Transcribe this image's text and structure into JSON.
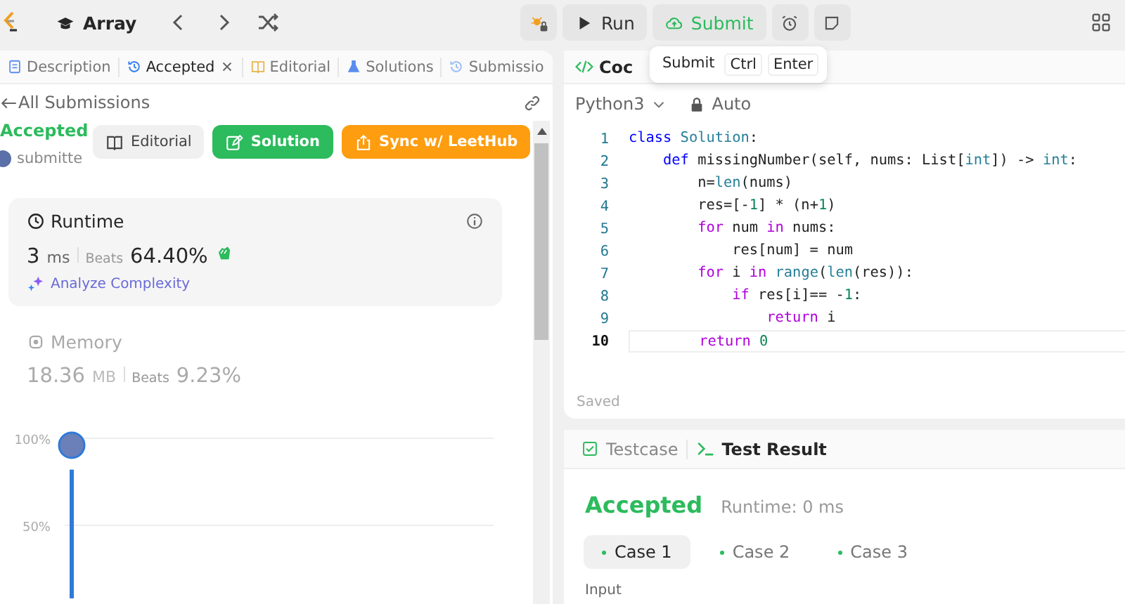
{
  "top_bar": {
    "problem_list": "Array",
    "actions": [
      {
        "label": "Run",
        "kind": "run"
      },
      {
        "label": "Submit",
        "kind": "submit"
      }
    ],
    "tooltip": [
      "Submit",
      "Ctrl",
      "Enter"
    ]
  },
  "left_panel": {
    "tabs": [
      {
        "label": "Description",
        "selected": false,
        "closable": false
      },
      {
        "label": "Accepted",
        "selected": true,
        "closable": true
      },
      {
        "label": "Editorial",
        "selected": false,
        "closable": false
      },
      {
        "label": "Solutions",
        "selected": false,
        "closable": false
      },
      {
        "label": "Submissio",
        "selected": false,
        "closable": false
      }
    ],
    "back_link": "All Submissions",
    "status": "Accepted",
    "author": "submitte",
    "buttons": [
      {
        "label": "Editorial",
        "kind": "plain"
      },
      {
        "label": "Solution",
        "kind": "green"
      },
      {
        "label": "Sync w/ LeetHub",
        "kind": "orange"
      }
    ],
    "runtime": {
      "title": "Runtime",
      "value": "3",
      "unit": "ms",
      "beats_label": "Beats",
      "beats": "64.40%",
      "link": "Analyze Complexity"
    },
    "memory": {
      "title": "Memory",
      "value": "18.36",
      "unit": "MB",
      "beats_label": "Beats",
      "beats": "9.23%"
    },
    "chart_data": {
      "type": "bar",
      "values": [
        82
      ],
      "ylim": [
        0,
        100
      ],
      "yticks": [
        {
          "value": 100,
          "label": "100%"
        },
        {
          "value": 50,
          "label": "50%"
        }
      ]
    }
  },
  "code_panel": {
    "tab": "Coc",
    "language": "Python3",
    "mode": "Auto",
    "lines": [
      {
        "number": "1",
        "active": false,
        "tokens": [
          {
            "t": "class",
            "kind": "keyword"
          },
          {
            "t": " Solution",
            "kind": "builtin"
          },
          {
            "t": ":",
            "kind": "plain"
          }
        ]
      },
      {
        "number": "2",
        "active": false,
        "tokens": [
          {
            "t": "    def",
            "kind": "keyword"
          },
          {
            "t": " missingNumber(self, nums: List[",
            "kind": "plain"
          },
          {
            "t": "int",
            "kind": "builtin"
          },
          {
            "t": "]) -> ",
            "kind": "plain"
          },
          {
            "t": "int",
            "kind": "builtin"
          },
          {
            "t": ":",
            "kind": "plain"
          }
        ]
      },
      {
        "number": "3",
        "active": false,
        "tokens": [
          {
            "t": "        n=",
            "kind": "plain"
          },
          {
            "t": "len",
            "kind": "builtin"
          },
          {
            "t": "(nums)",
            "kind": "plain"
          }
        ]
      },
      {
        "number": "4",
        "active": false,
        "tokens": [
          {
            "t": "        res=[-",
            "kind": "plain"
          },
          {
            "t": "1",
            "kind": "number"
          },
          {
            "t": "] * (n+",
            "kind": "plain"
          },
          {
            "t": "1",
            "kind": "number"
          },
          {
            "t": ")",
            "kind": "plain"
          }
        ]
      },
      {
        "number": "5",
        "active": false,
        "tokens": [
          {
            "t": "        for",
            "kind": "control"
          },
          {
            "t": " num ",
            "kind": "plain"
          },
          {
            "t": "in",
            "kind": "control"
          },
          {
            "t": " nums:",
            "kind": "plain"
          }
        ]
      },
      {
        "number": "6",
        "active": false,
        "tokens": [
          {
            "t": "            res[num] = num",
            "kind": "plain"
          }
        ]
      },
      {
        "number": "7",
        "active": false,
        "tokens": [
          {
            "t": "        for",
            "kind": "control"
          },
          {
            "t": " i ",
            "kind": "plain"
          },
          {
            "t": "in",
            "kind": "control"
          },
          {
            "t": " range",
            "kind": "builtin"
          },
          {
            "t": "(",
            "kind": "plain"
          },
          {
            "t": "len",
            "kind": "builtin"
          },
          {
            "t": "(res)):",
            "kind": "plain"
          }
        ]
      },
      {
        "number": "8",
        "active": false,
        "tokens": [
          {
            "t": "            if",
            "kind": "control"
          },
          {
            "t": " res[i]== -",
            "kind": "plain"
          },
          {
            "t": "1",
            "kind": "number"
          },
          {
            "t": ":",
            "kind": "plain"
          }
        ]
      },
      {
        "number": "9",
        "active": false,
        "tokens": [
          {
            "t": "                return",
            "kind": "control"
          },
          {
            "t": " i",
            "kind": "plain"
          }
        ]
      },
      {
        "number": "10",
        "active": true,
        "tokens": [
          {
            "t": "        return",
            "kind": "control"
          },
          {
            "t": " 0",
            "kind": "number"
          }
        ]
      }
    ],
    "status": "Saved"
  },
  "result_panel": {
    "tabs": [
      {
        "label": "Testcase",
        "selected": false
      },
      {
        "label": "Test Result",
        "selected": true
      }
    ],
    "verdict": "Accepted",
    "runtime": "Runtime: 0 ms",
    "cases": [
      {
        "label": "Case 1",
        "selected": true
      },
      {
        "label": "Case 2",
        "selected": false
      },
      {
        "label": "Case 3",
        "selected": false
      }
    ],
    "input_label": "Input"
  }
}
